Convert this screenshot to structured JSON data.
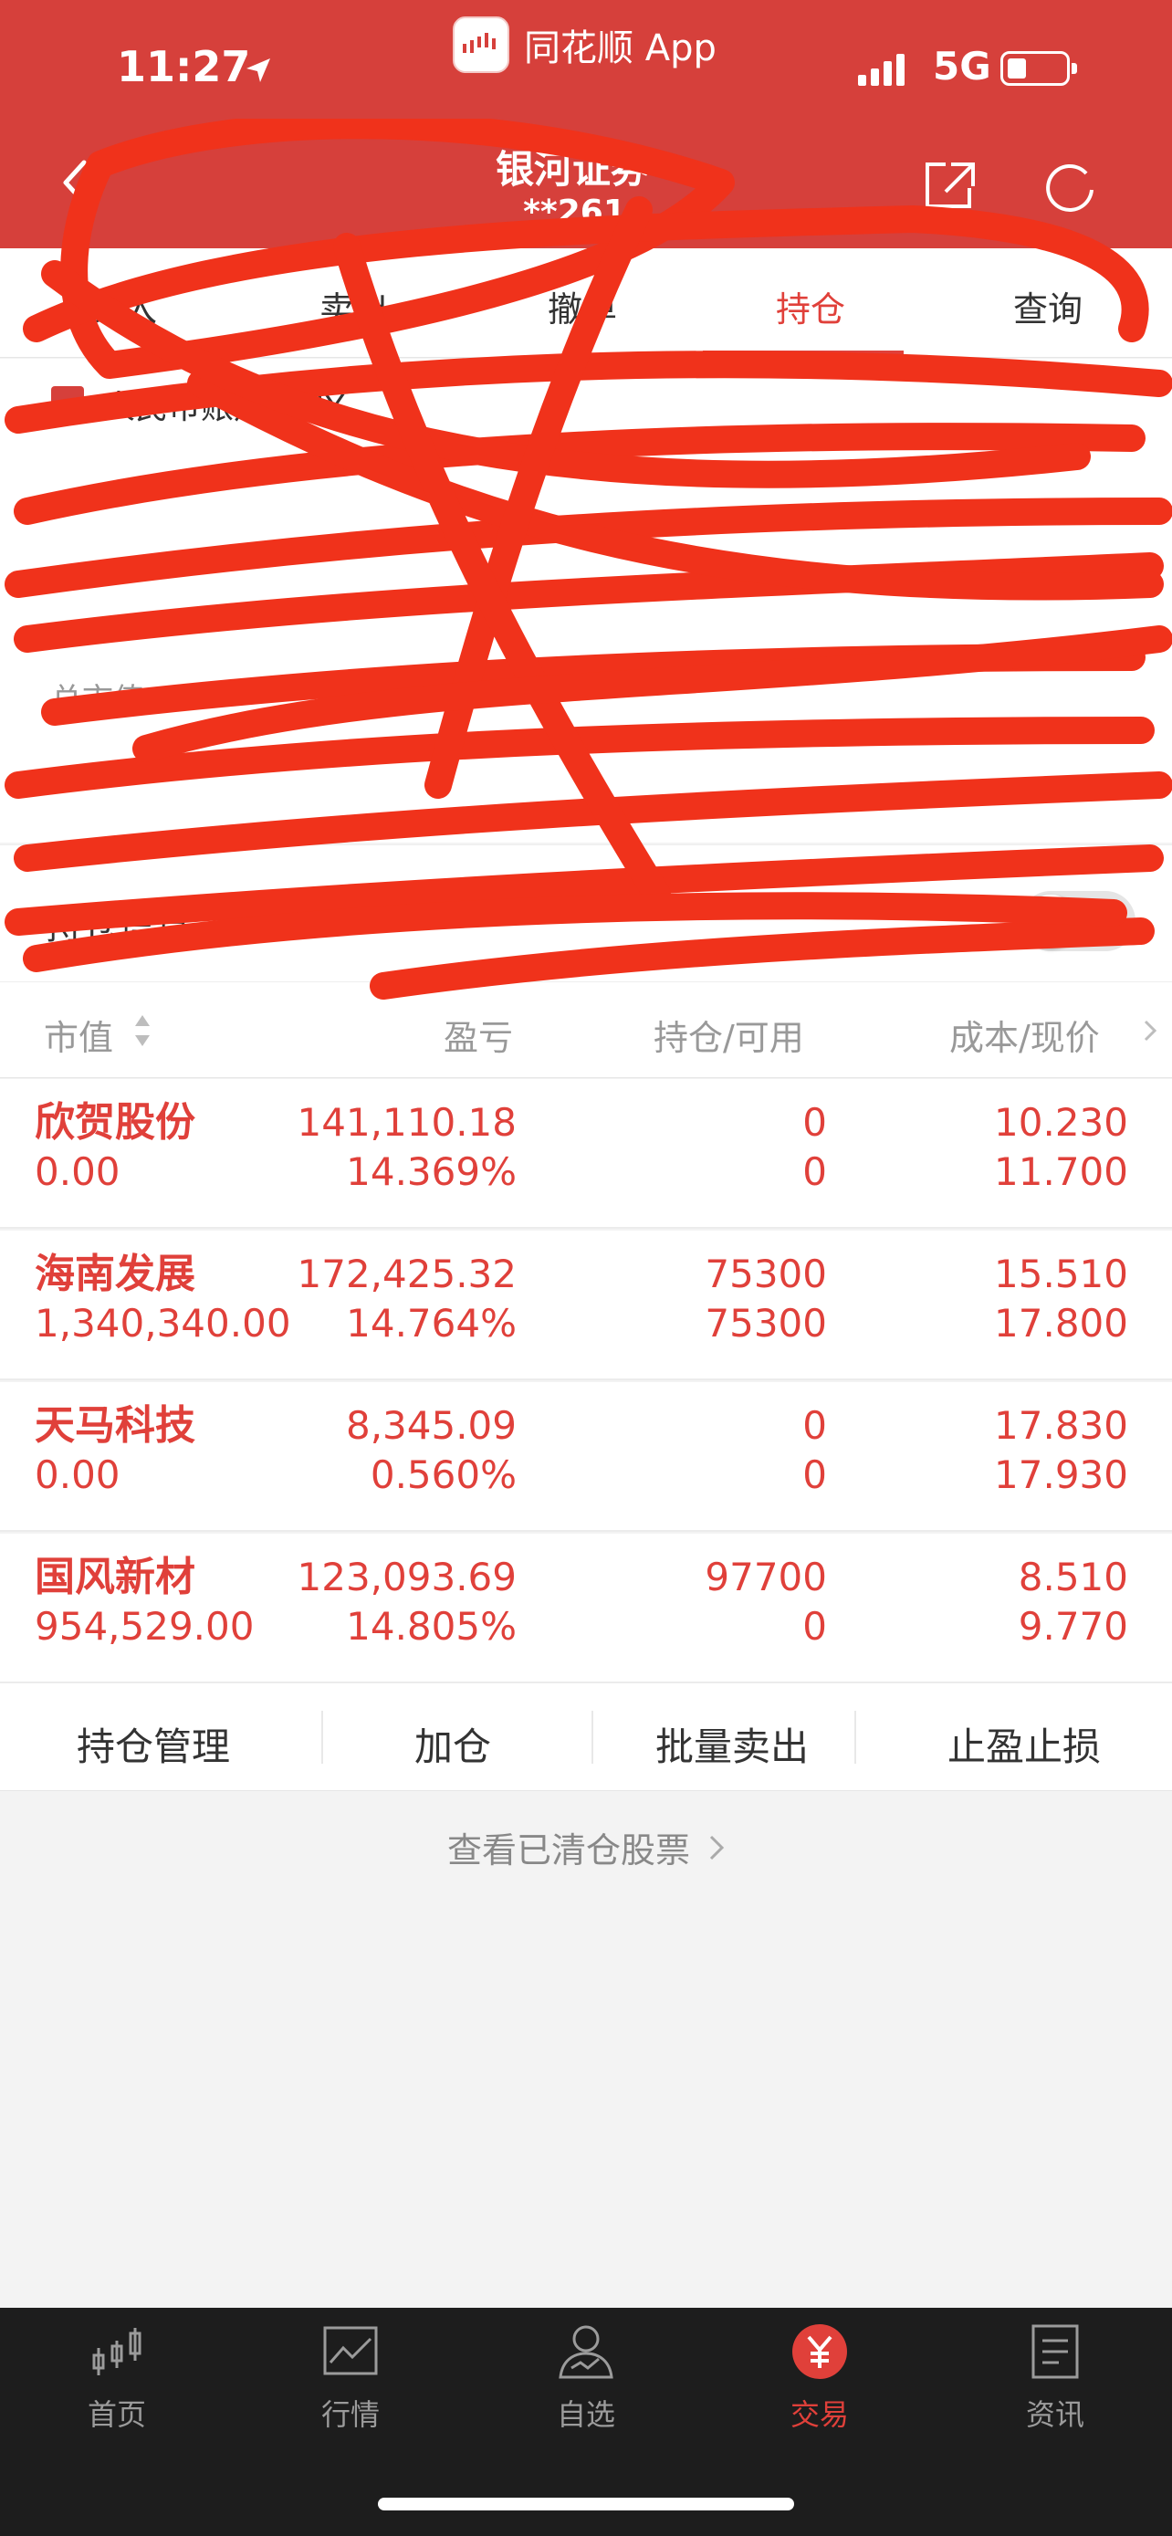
{
  "status_bar": {
    "time": "11:27",
    "app_caption": "同花顺 App",
    "network": "5G"
  },
  "header": {
    "title": "银河证券",
    "subtitle": "**2619"
  },
  "tabs": [
    {
      "label": "买入"
    },
    {
      "label": "卖出"
    },
    {
      "label": "撤单"
    },
    {
      "label": "持仓"
    },
    {
      "label": "查询"
    }
  ],
  "account": {
    "label": "人民币账户 CNY",
    "total_label": "总市值"
  },
  "holdings": {
    "title": "持仓信息",
    "columns": {
      "market_value": "市值",
      "pl": "盈亏",
      "position": "持仓/可用",
      "cost_price": "成本/现价"
    },
    "rows": [
      {
        "name": "欣贺股份",
        "market_value": "0.00",
        "pl": "141,110.18",
        "pl_pct": "14.369%",
        "position": "0",
        "available": "0",
        "cost": "10.230",
        "price": "11.700"
      },
      {
        "name": "海南发展",
        "market_value": "1,340,340.00",
        "pl": "172,425.32",
        "pl_pct": "14.764%",
        "position": "75300",
        "available": "75300",
        "cost": "15.510",
        "price": "17.800"
      },
      {
        "name": "天马科技",
        "market_value": "0.00",
        "pl": "8,345.09",
        "pl_pct": "0.560%",
        "position": "0",
        "available": "0",
        "cost": "17.830",
        "price": "17.930"
      },
      {
        "name": "国风新材",
        "market_value": "954,529.00",
        "pl": "123,093.69",
        "pl_pct": "14.805%",
        "position": "97700",
        "available": "0",
        "cost": "8.510",
        "price": "9.770"
      }
    ]
  },
  "actions": {
    "manage": "持仓管理",
    "add": "加仓",
    "batch_sell": "批量卖出",
    "stop": "止盈止损"
  },
  "cleared_link": "查看已清仓股票",
  "tabbar": [
    {
      "label": "首页",
      "icon": "candlestick-icon"
    },
    {
      "label": "行情",
      "icon": "chart-icon"
    },
    {
      "label": "自选",
      "icon": "person-icon"
    },
    {
      "label": "交易",
      "icon": "yuan-icon"
    },
    {
      "label": "资讯",
      "icon": "news-icon"
    }
  ],
  "colors": {
    "header_red": "#d6403b",
    "accent_red": "#e0403a",
    "tabbar_bg": "#1d1d1d",
    "scribble": "#f0321b"
  }
}
